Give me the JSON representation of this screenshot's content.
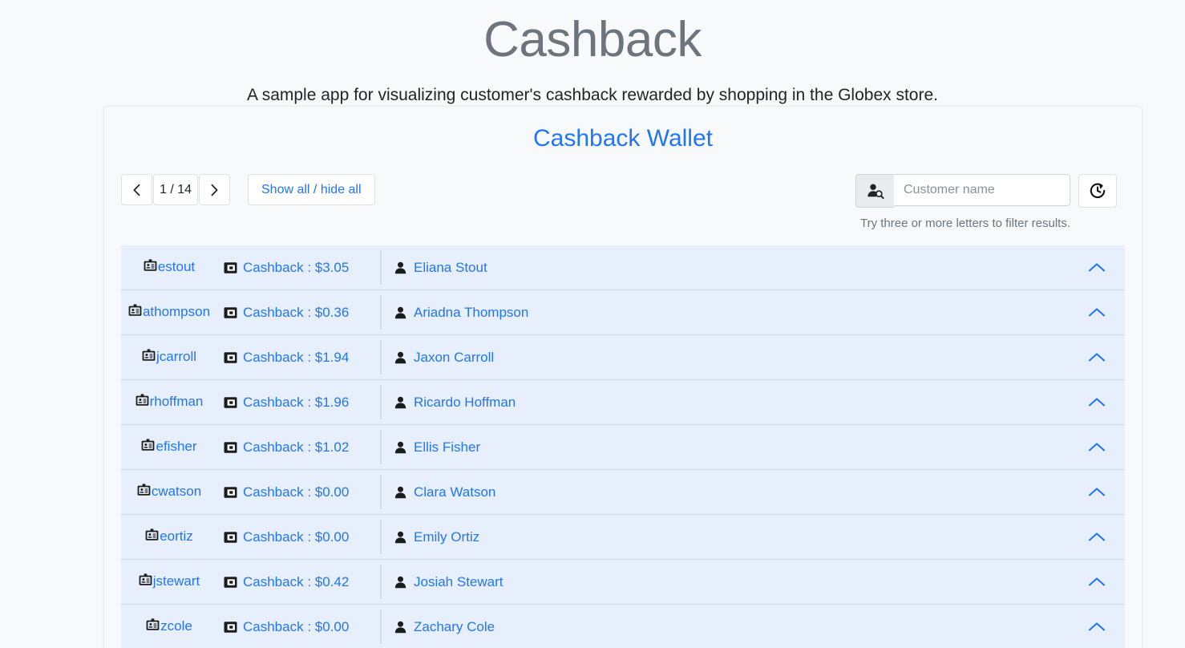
{
  "header": {
    "title": "Cashback",
    "subtitle": "A sample app for visualizing customer's cashback rewarded by shopping in the Globex store."
  },
  "card": {
    "title": "Cashback Wallet"
  },
  "toolbar": {
    "prev_label": "‹",
    "next_label": "›",
    "page_counter": "1 / 14",
    "show_all_label": "Show all / hide all"
  },
  "search": {
    "placeholder": "Customer name",
    "value": "",
    "hint": "Try three or more letters to filter results.",
    "prefix_icon": "user-search-icon",
    "reset_icon": "clock-rotate-left-icon"
  },
  "colors": {
    "link": "#2176f5",
    "title_gray": "#6c757d",
    "row_bg": "#e7effd",
    "page_bg": "#f8f9fa"
  },
  "list": {
    "cashback_prefix": "Cashback : ",
    "rows": [
      {
        "username": "estout",
        "cashback": "Cashback : $3.05",
        "name": "Eliana Stout"
      },
      {
        "username": "athompson",
        "cashback": "Cashback : $0.36",
        "name": "Ariadna Thompson"
      },
      {
        "username": "jcarroll",
        "cashback": "Cashback : $1.94",
        "name": "Jaxon Carroll"
      },
      {
        "username": "rhoffman",
        "cashback": "Cashback : $1.96",
        "name": "Ricardo Hoffman"
      },
      {
        "username": "efisher",
        "cashback": "Cashback : $1.02",
        "name": "Ellis Fisher"
      },
      {
        "username": "cwatson",
        "cashback": "Cashback : $0.00",
        "name": "Clara Watson"
      },
      {
        "username": "eortiz",
        "cashback": "Cashback : $0.00",
        "name": "Emily Ortiz"
      },
      {
        "username": "jstewart",
        "cashback": "Cashback : $0.42",
        "name": "Josiah Stewart"
      },
      {
        "username": "zcole",
        "cashback": "Cashback : $0.00",
        "name": "Zachary Cole"
      }
    ]
  }
}
